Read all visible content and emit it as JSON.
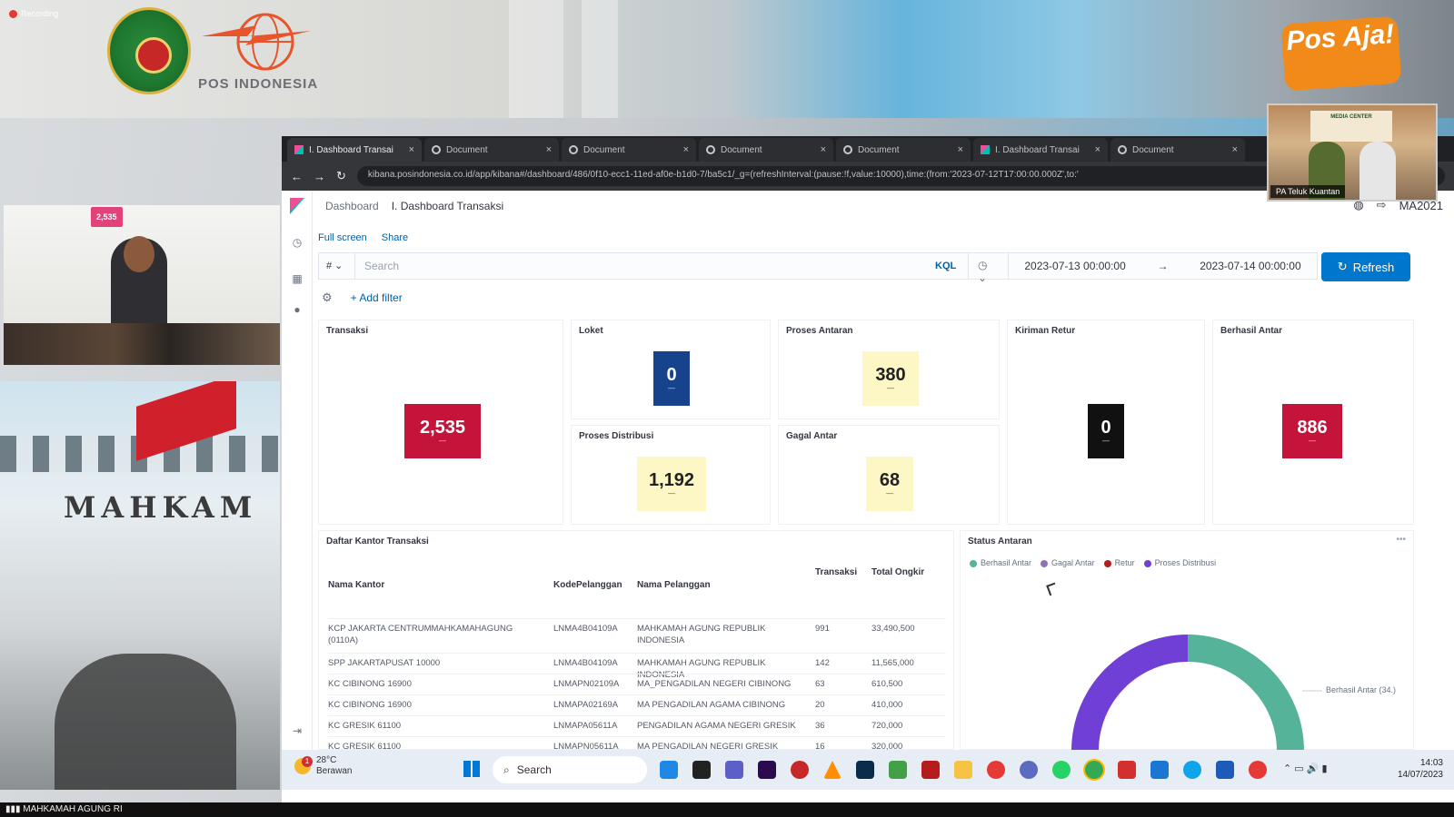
{
  "overlay": {
    "recording": "Recording",
    "org_logo_text": "POS INDONESIA",
    "pos_aja": "Pos Aja!",
    "building_text": "MAHKAM",
    "screen_badge": "2,535",
    "pip_label": "PA Teluk Kuantan",
    "pip_board": "MEDIA CENTER",
    "bottom_caption": "MAHKAMAH AGUNG RI"
  },
  "browser": {
    "tabs": [
      {
        "title": "I. Dashboard Transai",
        "active": true,
        "kibana": true
      },
      {
        "title": "Document",
        "active": false,
        "kibana": false
      },
      {
        "title": "Document",
        "active": false,
        "kibana": false
      },
      {
        "title": "Document",
        "active": false,
        "kibana": false
      },
      {
        "title": "Document",
        "active": false,
        "kibana": false
      },
      {
        "title": "I. Dashboard Transai",
        "active": false,
        "kibana": true
      },
      {
        "title": "Document",
        "active": false,
        "kibana": false
      }
    ],
    "url": "kibana.posindonesia.co.id/app/kibana#/dashboard/486/0f10-ecc1-11ed-af0e-b1d0-7/ba5c1/_g=(refreshInterval:(pause:!f,value:10000),time:(from:'2023-07-12T17:00:00.000Z',to:'"
  },
  "kibana": {
    "breadcrumbs": {
      "root": "Dashboard",
      "current": "I. Dashboard Transaksi"
    },
    "user": "MA2021",
    "subnav": {
      "fullscreen": "Full screen",
      "share": "Share"
    },
    "query": {
      "toggle": "#",
      "placeholder": "Search",
      "kql": "KQL"
    },
    "time": {
      "from": "2023-07-13 00:00:00",
      "arrow": "→",
      "to": "2023-07-14 00:00:00"
    },
    "refresh_label": "Refresh",
    "add_filter": "+ Add filter",
    "metrics": {
      "transaksi": {
        "title": "Transaksi",
        "value": "2,535",
        "sub": "—"
      },
      "loket": {
        "title": "Loket",
        "value": "0",
        "sub": "—"
      },
      "proses_antaran": {
        "title": "Proses Antaran",
        "value": "380",
        "sub": "—"
      },
      "kiriman_retur": {
        "title": "Kiriman Retur",
        "value": "0",
        "sub": "—"
      },
      "berhasil_antar": {
        "title": "Berhasil Antar",
        "value": "886",
        "sub": "—"
      },
      "proses_distribusi": {
        "title": "Proses Distribusi",
        "value": "1,192",
        "sub": "—"
      },
      "gagal_antar": {
        "title": "Gagal Antar",
        "value": "68",
        "sub": "—"
      }
    },
    "table": {
      "title": "Daftar Kantor Transaksi",
      "headers": [
        "Nama Kantor",
        "KodePelanggan",
        "Nama Pelanggan",
        "Transaksi",
        "Total Ongkir"
      ],
      "rows": [
        [
          "KCP JAKARTA CENTRUMMAHKAMAHAGUNG (0110A)",
          "LNMA4B04109A",
          "MAHKAMAH AGUNG REPUBLIK INDONESIA",
          "991",
          "33,490,500"
        ],
        [
          "SPP JAKARTAPUSAT 10000",
          "LNMA4B04109A",
          "MAHKAMAH AGUNG REPUBLIK INDONESIA",
          "142",
          "11,565,000"
        ],
        [
          "KC CIBINONG 16900",
          "LNMAPN02109A",
          "MA_PENGADILAN NEGERI CIBINONG",
          "63",
          "610,500"
        ],
        [
          "KC CIBINONG 16900",
          "LNMAPA02169A",
          "MA PENGADILAN AGAMA CIBINONG",
          "20",
          "410,000"
        ],
        [
          "KC GRESIK 61100",
          "LNMAPA05611A",
          "PENGADILAN AGAMA NEGERI GRESIK",
          "36",
          "720,000"
        ],
        [
          "KC GRESIK 61100",
          "LNMAPN05611A",
          "MA PENGADILAN NEGERI GRESIK",
          "16",
          "320,000"
        ]
      ]
    },
    "status_antaran": {
      "title": "Status Antaran",
      "legend": [
        {
          "label": "Berhasil Antar",
          "color": "#54b399"
        },
        {
          "label": "Gagal Antar",
          "color": "#9170b8"
        },
        {
          "label": "Retur",
          "color": "#b21e1e"
        },
        {
          "label": "Proses Distribusi",
          "color": "#6f3fd6"
        }
      ],
      "callout": "Berhasil Antar (34.)"
    }
  },
  "taskbar": {
    "temp": "28°C",
    "weather": "Berawan",
    "notif": "1",
    "search": "Search",
    "time": "14:03",
    "date": "14/07/2023"
  },
  "colors": {
    "metric_red": "#c4143a",
    "metric_navy": "#17428c",
    "metric_yellow": "#fdf7c6",
    "metric_black": "#111111",
    "accent_blue": "#0077cc"
  }
}
